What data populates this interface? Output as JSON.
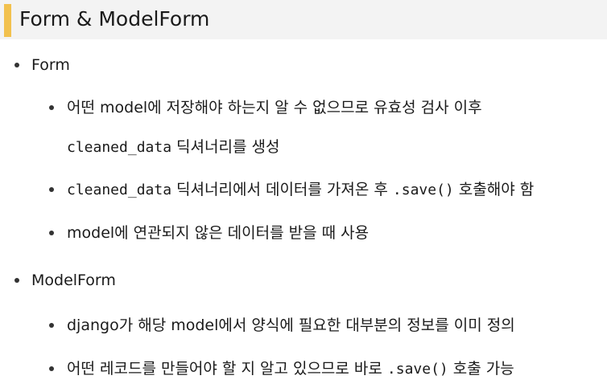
{
  "title": "Form & ModelForm",
  "sections": [
    {
      "heading": "Form",
      "items": [
        {
          "line1": "어떤 model에 저장해야 하는지 알 수 없으므로 유효성 검사 이후",
          "line2_code": "cleaned_data",
          "line2_text": "딕셔너리를 생성"
        },
        {
          "code1": "cleaned_data",
          "text1": "딕셔너리에서 데이터를 가져온 후",
          "code2": ".save()",
          "text2": "호출해야 함"
        },
        {
          "text": "model에 연관되지 않은 데이터를 받을 때 사용"
        }
      ]
    },
    {
      "heading": "ModelForm",
      "items": [
        {
          "text": "django가 해당 model에서 양식에 필요한 대부분의 정보를 이미 정의"
        },
        {
          "text1": "어떤 레코드를 만들어야 할 지 알고 있으므로 바로",
          "code1": ".save()",
          "text2": "호출 가능"
        }
      ]
    }
  ]
}
